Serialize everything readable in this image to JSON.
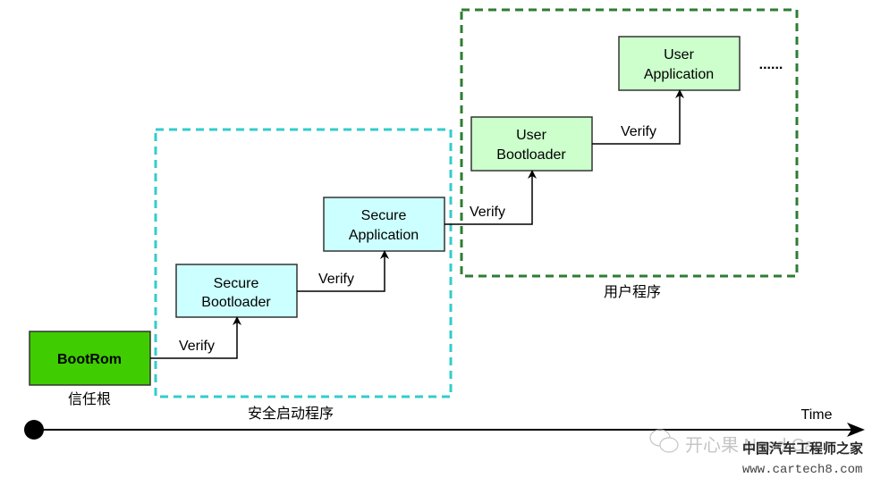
{
  "nodes": {
    "bootrom": {
      "label": "BootRom",
      "fill": "#3fcc00"
    },
    "secure_bootloader": {
      "line1": "Secure",
      "line2": "Bootloader",
      "fill": "#ccffff"
    },
    "secure_application": {
      "line1": "Secure",
      "line2": "Application",
      "fill": "#ccffff"
    },
    "user_bootloader": {
      "line1": "User",
      "line2": "Bootloader",
      "fill": "#ccffcc"
    },
    "user_application": {
      "line1": "User",
      "line2": "Application",
      "fill": "#ccffcc"
    },
    "ellipsis": "......"
  },
  "edges": [
    "Verify",
    "Verify",
    "Verify",
    "Verify"
  ],
  "groups": {
    "root_of_trust": "信任根",
    "secure_boot": {
      "label": "安全启动程序",
      "color": "#33cccc"
    },
    "user_program": {
      "label": "用户程序",
      "color": "#2e7d32"
    }
  },
  "timeline": {
    "label": "Time"
  },
  "watermark": {
    "account": "开心果 Need Car",
    "site_name": "中国汽车工程师之家",
    "url": "www.cartech8.com"
  }
}
